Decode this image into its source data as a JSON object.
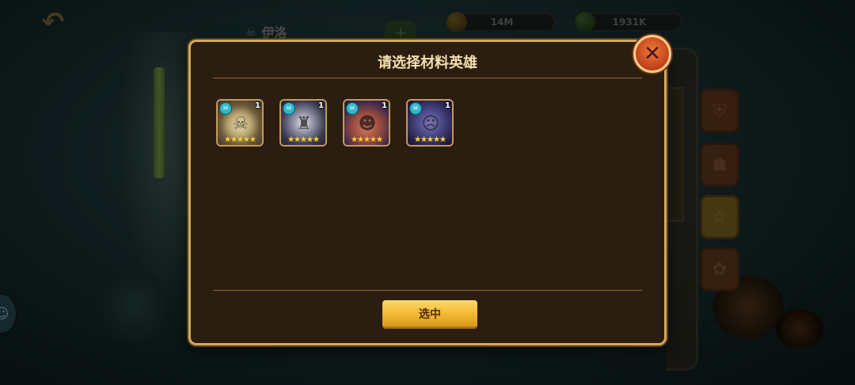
{
  "header": {
    "hero_name": "伊洛",
    "plus_label": "+"
  },
  "currency": {
    "gold": "14M",
    "gems": "1931K"
  },
  "modal": {
    "title": "请选择材料英雄",
    "select_label": "选中",
    "close_glyph": "✕"
  },
  "heroes": [
    {
      "level": "1",
      "stars": "★★★★★",
      "faction": "skull",
      "portrait": "skull-mage"
    },
    {
      "level": "1",
      "stars": "★★★★★",
      "faction": "skull",
      "portrait": "armored-knight"
    },
    {
      "level": "1",
      "stars": "★★★★★",
      "faction": "skull",
      "portrait": "pirate-tentacle"
    },
    {
      "level": "1",
      "stars": "★★★★★",
      "faction": "skull",
      "portrait": "dark-sorceress"
    }
  ],
  "colors": {
    "modal_border": "#d2a95a",
    "modal_bg": "#2b1d10",
    "button_gold": "#f2b631",
    "close_red": "#c0401a",
    "star_yellow": "#ffd23a",
    "faction_cyan": "#2fb5c8"
  },
  "icons": {
    "back": "back-arrow-icon",
    "close": "close-icon",
    "faction": "skull-faction-icon",
    "side_tabs": [
      "shield-icon",
      "tribal-mask-icon",
      "star-icon",
      "lotus-icon"
    ]
  }
}
